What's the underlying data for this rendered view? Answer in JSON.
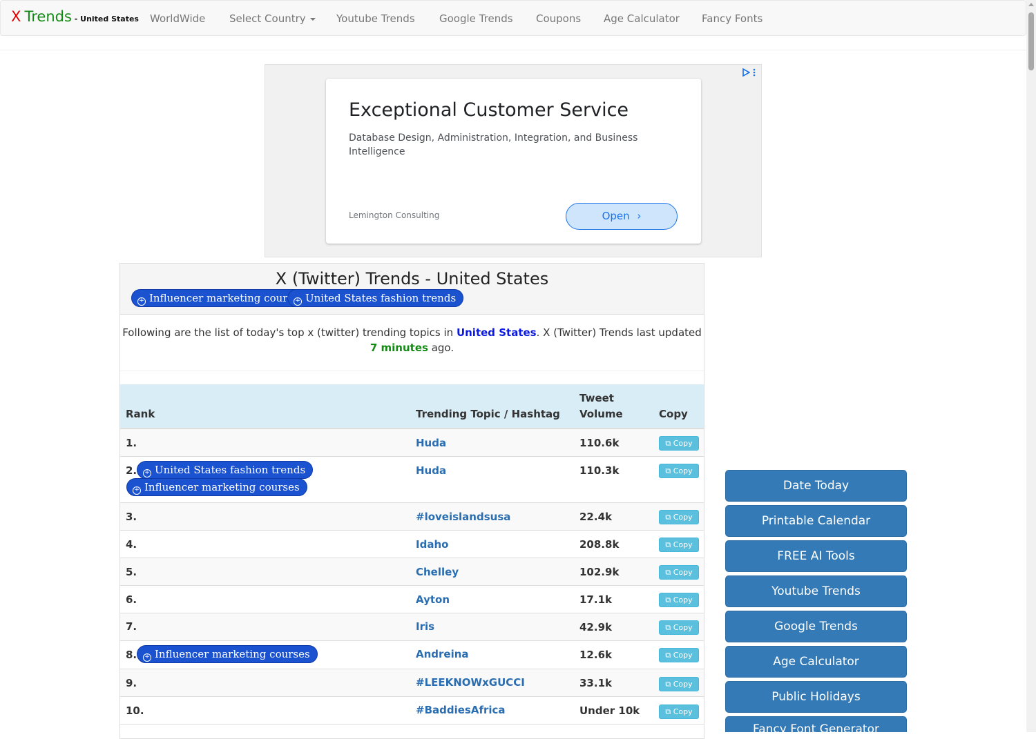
{
  "nav": {
    "brand_x": "X",
    "brand_trends": "Trends",
    "brand_country": " - United States",
    "items": [
      "WorldWide",
      "Select Country",
      "Youtube Trends",
      "Google Trends",
      "Coupons",
      "Age Calculator",
      "Fancy Fonts"
    ]
  },
  "ad": {
    "title": "Exceptional Customer Service",
    "description": "Database Design, Administration, Integration, and Business Intelligence",
    "advertiser": "Lemington Consulting",
    "cta": "Open"
  },
  "panel": {
    "title": "X (Twitter) Trends - United States",
    "header_pills": [
      "Influencer marketing courses",
      "United States fashion trends"
    ],
    "intro_before": "Following are the list of today's top x (twitter) trending topics in ",
    "intro_country": "United States",
    "intro_middle": ". X (Twitter) Trends last updated ",
    "intro_minutes": "7 minutes",
    "intro_after": " ago."
  },
  "table": {
    "headers": {
      "rank": "Rank",
      "topic": "Trending Topic / Hashtag",
      "volume": "Tweet Volume",
      "copy": "Copy"
    },
    "copy_label": "Copy",
    "rows": [
      {
        "rank": "1.",
        "topic": "Huda",
        "volume": "110.6k"
      },
      {
        "rank": "2.",
        "topic": "Huda",
        "volume": "110.3k",
        "pills": [
          "United States fashion trends",
          "Influencer marketing courses"
        ]
      },
      {
        "rank": "3.",
        "topic": "#loveislandsusa",
        "volume": "22.4k"
      },
      {
        "rank": "4.",
        "topic": "Idaho",
        "volume": "208.8k"
      },
      {
        "rank": "5.",
        "topic": "Chelley",
        "volume": "102.9k"
      },
      {
        "rank": "6.",
        "topic": "Ayton",
        "volume": "17.1k"
      },
      {
        "rank": "7.",
        "topic": "Iris",
        "volume": "42.9k"
      },
      {
        "rank": "8.",
        "topic": "Andreina",
        "volume": "12.6k",
        "pills": [
          "Influencer marketing courses"
        ]
      },
      {
        "rank": "9.",
        "topic": "#LEEKNOWxGUCCI",
        "volume": "33.1k"
      },
      {
        "rank": "10.",
        "topic": "#BaddiesAfrica",
        "volume": "Under 10k"
      }
    ]
  },
  "sidebar": {
    "buttons": [
      "Date Today",
      "Printable Calendar",
      "FREE AI Tools",
      "Youtube Trends",
      "Google Trends",
      "Age Calculator",
      "Public Holidays",
      "Fancy Font Generator"
    ]
  }
}
